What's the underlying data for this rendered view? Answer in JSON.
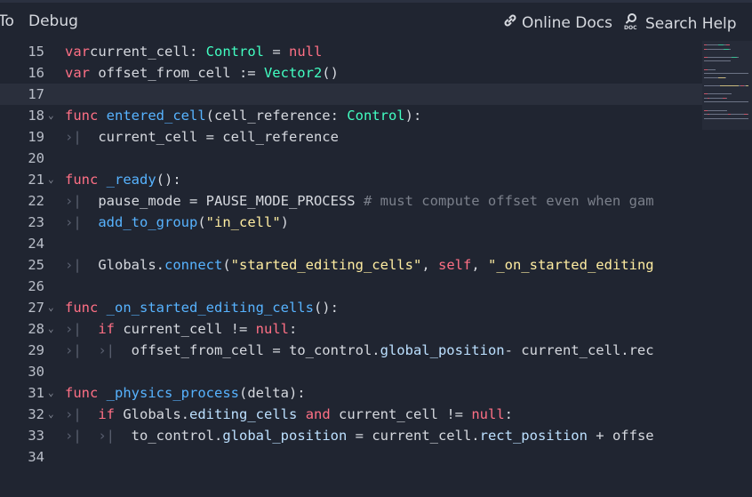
{
  "menubar": {
    "left_items": [
      "To",
      "Debug"
    ],
    "online_docs": "Online Docs",
    "search_help": "Search Help",
    "online_docs_icon": "link-icon",
    "search_help_icon": "doc-search-icon"
  },
  "editor": {
    "current_line": 17,
    "lines": [
      {
        "n": "15",
        "fold": false,
        "tokens": [
          [
            "kw",
            "var"
          ],
          [
            "",
            "current_cell: "
          ],
          [
            "ty",
            "Control"
          ],
          [
            "",
            " = "
          ],
          [
            "kw",
            "null"
          ]
        ]
      },
      {
        "n": "16",
        "fold": false,
        "tokens": [
          [
            "kw",
            "var"
          ],
          [
            "",
            " offset_from_cell := "
          ],
          [
            "ty",
            "Vector2"
          ],
          [
            "",
            "()"
          ]
        ]
      },
      {
        "n": "17",
        "fold": false,
        "tokens": []
      },
      {
        "n": "18",
        "fold": true,
        "tokens": [
          [
            "kw",
            "func"
          ],
          [
            "",
            " "
          ],
          [
            "fn",
            "entered_cell"
          ],
          [
            "",
            "(cell_reference: "
          ],
          [
            "ty",
            "Control"
          ],
          [
            "",
            "):"
          ]
        ]
      },
      {
        "n": "19",
        "fold": false,
        "tokens": [
          [
            "tab",
            "›|"
          ],
          [
            "",
            "  current_cell = cell_reference"
          ]
        ]
      },
      {
        "n": "20",
        "fold": false,
        "tokens": []
      },
      {
        "n": "21",
        "fold": true,
        "tokens": [
          [
            "kw",
            "func"
          ],
          [
            "",
            " "
          ],
          [
            "fn",
            "_ready"
          ],
          [
            "",
            "():"
          ]
        ]
      },
      {
        "n": "22",
        "fold": false,
        "tokens": [
          [
            "tab",
            "›|"
          ],
          [
            "",
            "  pause_mode = PAUSE_MODE_PROCESS "
          ],
          [
            "cm",
            "# must compute offset even when gam"
          ]
        ]
      },
      {
        "n": "23",
        "fold": false,
        "tokens": [
          [
            "tab",
            "›|"
          ],
          [
            "",
            "  "
          ],
          [
            "fn",
            "add_to_group"
          ],
          [
            "",
            "("
          ],
          [
            "st",
            "\"in_cell\""
          ],
          [
            "",
            ")"
          ]
        ]
      },
      {
        "n": "24",
        "fold": false,
        "tokens": []
      },
      {
        "n": "25",
        "fold": false,
        "tokens": [
          [
            "tab",
            "›|"
          ],
          [
            "",
            "  Globals."
          ],
          [
            "fn",
            "connect"
          ],
          [
            "",
            "("
          ],
          [
            "st",
            "\"started_editing_cells\""
          ],
          [
            "",
            ", "
          ],
          [
            "kw",
            "self"
          ],
          [
            "",
            ", "
          ],
          [
            "st",
            "\"_on_started_editing"
          ]
        ]
      },
      {
        "n": "26",
        "fold": false,
        "tokens": []
      },
      {
        "n": "27",
        "fold": true,
        "tokens": [
          [
            "kw",
            "func"
          ],
          [
            "",
            " "
          ],
          [
            "fn",
            "_on_started_editing_cells"
          ],
          [
            "",
            "():"
          ]
        ]
      },
      {
        "n": "28",
        "fold": true,
        "tokens": [
          [
            "tab",
            "›|"
          ],
          [
            "",
            "  "
          ],
          [
            "kw",
            "if"
          ],
          [
            "",
            " current_cell != "
          ],
          [
            "kw",
            "null"
          ],
          [
            "",
            ":"
          ]
        ]
      },
      {
        "n": "29",
        "fold": false,
        "tokens": [
          [
            "tab",
            "›|"
          ],
          [
            "",
            "  "
          ],
          [
            "tab",
            "›|"
          ],
          [
            "",
            "  offset_from_cell = to_control."
          ],
          [
            "mp",
            "global_position"
          ],
          [
            "",
            "- current_cell.rec"
          ]
        ]
      },
      {
        "n": "30",
        "fold": false,
        "tokens": []
      },
      {
        "n": "31",
        "fold": true,
        "tokens": [
          [
            "kw",
            "func"
          ],
          [
            "",
            " "
          ],
          [
            "fn",
            "_physics_process"
          ],
          [
            "",
            "(delta):"
          ]
        ]
      },
      {
        "n": "32",
        "fold": true,
        "tokens": [
          [
            "tab",
            "›|"
          ],
          [
            "",
            "  "
          ],
          [
            "kw",
            "if"
          ],
          [
            "",
            " Globals."
          ],
          [
            "mp",
            "editing_cells"
          ],
          [
            "",
            " "
          ],
          [
            "kw",
            "and"
          ],
          [
            "",
            " current_cell != "
          ],
          [
            "kw",
            "null"
          ],
          [
            "",
            ":"
          ]
        ]
      },
      {
        "n": "33",
        "fold": false,
        "tokens": [
          [
            "tab",
            "›|"
          ],
          [
            "",
            "  "
          ],
          [
            "tab",
            "›|"
          ],
          [
            "",
            "  to_control."
          ],
          [
            "mp",
            "global_position"
          ],
          [
            "",
            " = current_cell."
          ],
          [
            "mp",
            "rect_position"
          ],
          [
            "",
            " + offse"
          ]
        ]
      },
      {
        "n": "34",
        "fold": false,
        "tokens": []
      }
    ]
  },
  "colors": {
    "background": "#202531",
    "keyword": "#ff7085",
    "type": "#42ffc2",
    "function": "#57b3ff",
    "string": "#ffeda1",
    "comment": "#7b808b",
    "member": "#bce0ff"
  }
}
